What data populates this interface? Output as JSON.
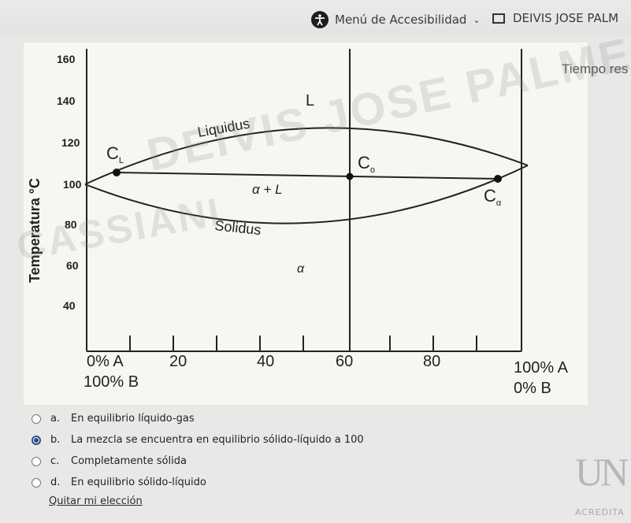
{
  "header": {
    "accessibility_menu": "Menú de Accesibilidad",
    "user_name": "DEIVIS JOSE PALM"
  },
  "timer_label": "Tiempo res",
  "watermarks": [
    "DEIVIS JOSE PALMERA",
    "CASSIANI"
  ],
  "diagram": {
    "y_axis_label": "Temperatura °C",
    "y_ticks": [
      "160",
      "140",
      "120",
      "100",
      "80",
      "60",
      "40"
    ],
    "x_ticks": [
      "0% A",
      "20",
      "40",
      "60",
      "80",
      "100% A"
    ],
    "x_bottom_left": "100% B",
    "x_bottom_right": "0% B",
    "labels": {
      "L": "L",
      "liquidus": "Liquidus",
      "solidus": "Solidus",
      "alpha_L": "α + L",
      "alpha": "α",
      "C_left": "C",
      "C_left_sub": "L",
      "C_mid": "C",
      "C_mid_sub": "o",
      "C_right": "C",
      "C_right_sub": "α"
    }
  },
  "options": [
    {
      "letter": "a.",
      "text": "En equilibrio líquido-gas",
      "selected": false
    },
    {
      "letter": "b.",
      "text": "La mezcla se encuentra en equilibrio sólido-líquido a 100",
      "selected": true
    },
    {
      "letter": "c.",
      "text": "Completamente sólida",
      "selected": false
    },
    {
      "letter": "d.",
      "text": "En equilibrio sólido-líquido",
      "selected": false
    }
  ],
  "clear_choice": "Quitar mi elección",
  "university_logo": "UN",
  "accreditation": "ACREDITA"
}
